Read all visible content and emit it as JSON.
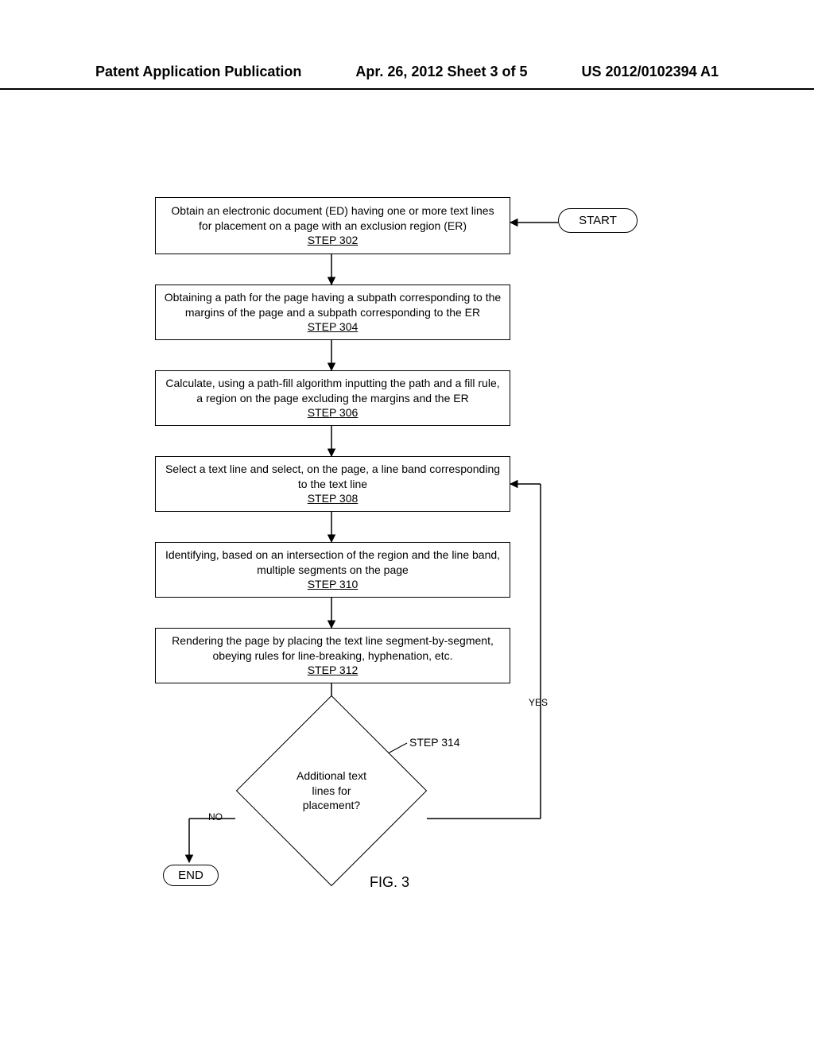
{
  "header": {
    "left": "Patent Application Publication",
    "center": "Apr. 26, 2012  Sheet 3 of 5",
    "right": "US 2012/0102394 A1"
  },
  "terminators": {
    "start": "START",
    "end": "END"
  },
  "steps": {
    "s302": {
      "text": "Obtain an electronic document (ED) having one or more text lines for placement on a page with an exclusion region (ER)",
      "label": "STEP 302"
    },
    "s304": {
      "text": "Obtaining a path for the page having a subpath corresponding to the margins of the page and a subpath corresponding to the ER",
      "label": "STEP 304"
    },
    "s306": {
      "text": "Calculate, using a path-fill algorithm inputting the path and a fill rule, a region on the page excluding the margins and the ER",
      "label": "STEP 306"
    },
    "s308": {
      "text": "Select a text line and select, on the page, a line band corresponding to the text line",
      "label": "STEP 308"
    },
    "s310": {
      "text": "Identifying, based on an intersection of the region and the line band, multiple segments on the page",
      "label": "STEP 310"
    },
    "s312": {
      "text": "Rendering the page by placing the text line segment-by-segment, obeying rules for line-breaking, hyphenation, etc.",
      "label": "STEP 312"
    }
  },
  "decision": {
    "text": "Additional text lines for placement?",
    "label": "STEP 314"
  },
  "edges": {
    "yes": "YES",
    "no": "NO"
  },
  "figure": "FIG. 3"
}
